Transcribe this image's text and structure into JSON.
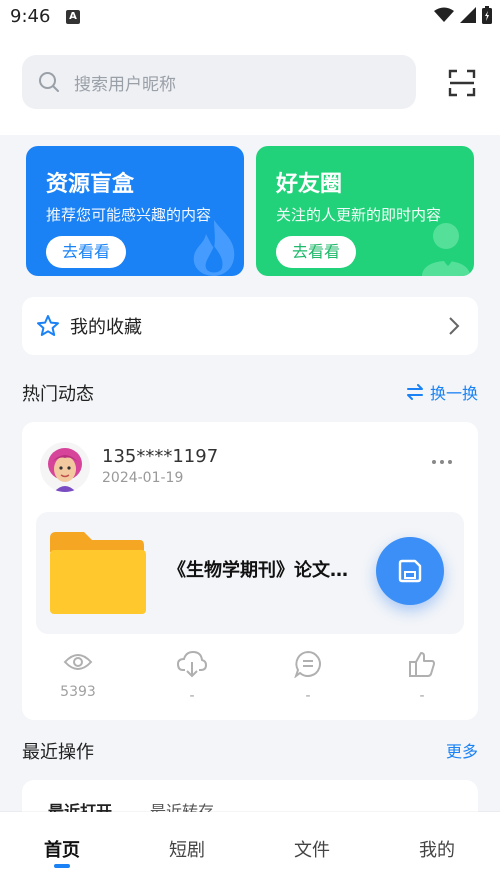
{
  "status_bar": {
    "time": "9:46",
    "notification_badge": "A"
  },
  "search": {
    "placeholder": "搜索用户昵称"
  },
  "promos": [
    {
      "title": "资源盲盒",
      "subtitle": "推荐您可能感兴趣的内容",
      "button": "去看看",
      "color": "#1a82f5"
    },
    {
      "title": "好友圈",
      "subtitle": "关注的人更新的即时内容",
      "button": "去看看",
      "color": "#22d27a"
    }
  ],
  "favorites": {
    "label": "我的收藏"
  },
  "hot": {
    "title": "热门动态",
    "refresh_label": "换一换"
  },
  "post": {
    "user": "135****1197",
    "date": "2024-01-19",
    "file_name": "《生物学期刊》论文…",
    "stats": [
      {
        "icon": "eye-icon",
        "value": "5393"
      },
      {
        "icon": "download-cloud-icon",
        "value": "-"
      },
      {
        "icon": "comment-icon",
        "value": "-"
      },
      {
        "icon": "thumbs-up-icon",
        "value": "-"
      }
    ]
  },
  "recent": {
    "title": "最近操作",
    "more": "更多",
    "tabs": [
      "最近打开",
      "最近转存"
    ]
  },
  "tabbar": {
    "items": [
      "首页",
      "短剧",
      "文件",
      "我的"
    ],
    "active": "首页"
  },
  "colors": {
    "accent": "#1a82f5",
    "green": "#22d27a"
  }
}
